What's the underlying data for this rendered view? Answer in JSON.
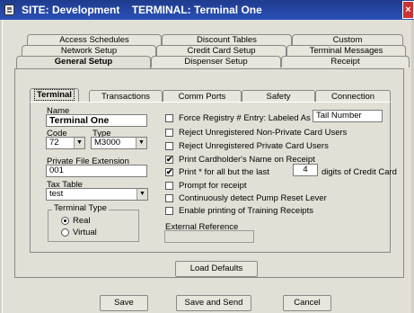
{
  "window": {
    "title": "SITE: Development    TERMINAL: Terminal One",
    "close_glyph": "×"
  },
  "top_tabs": {
    "row1": [
      "Access Schedules",
      "Discount Tables",
      "Custom"
    ],
    "row2": [
      "Network Setup",
      "Credit Card Setup",
      "Terminal Messages"
    ],
    "row3": [
      "General Setup",
      "Dispenser Setup",
      "Receipt"
    ]
  },
  "inner_tabs": [
    "Terminal",
    "Transactions",
    "Comm Ports",
    "Safety",
    "Connection"
  ],
  "form": {
    "name_label": "Name",
    "name_value": "Terminal One",
    "code_label": "Code",
    "code_value": "72",
    "type_label": "Type",
    "type_value": "M3000",
    "private_ext_label": "Private File Extension",
    "private_ext_value": "001",
    "tax_table_label": "Tax Table",
    "tax_table_value": "test",
    "terminal_type_label": "Terminal Type",
    "terminal_type_options": [
      "Real",
      "Virtual"
    ],
    "terminal_type_selected": "Real",
    "external_ref_label": "External Reference",
    "external_ref_value": ""
  },
  "options": {
    "force_registry_label": "Force Registry # Entry: Labeled As",
    "force_registry_value": "Tail Number",
    "force_registry_checked": false,
    "reject_nonprivate_label": "Reject Unregistered Non-Private Card Users",
    "reject_nonprivate_checked": false,
    "reject_private_label": "Reject Unregistered Private Card Users",
    "reject_private_checked": false,
    "print_name_label": "Print Cardholder's Name on Receipt",
    "print_name_checked": true,
    "print_mask_prefix": "Print * for all but the last",
    "print_mask_digits": "4",
    "print_mask_suffix": "digits of Credit Card",
    "print_mask_checked": true,
    "prompt_receipt_label": "Prompt for receipt",
    "prompt_receipt_checked": false,
    "detect_pump_label": "Continuously detect Pump Reset Lever",
    "detect_pump_checked": false,
    "training_receipts_label": "Enable printing of Training Receipts",
    "training_receipts_checked": false,
    "check_mark": "✔"
  },
  "buttons": {
    "load_defaults": "Load Defaults",
    "save": "Save",
    "save_and_send": "Save and Send",
    "cancel": "Cancel"
  }
}
